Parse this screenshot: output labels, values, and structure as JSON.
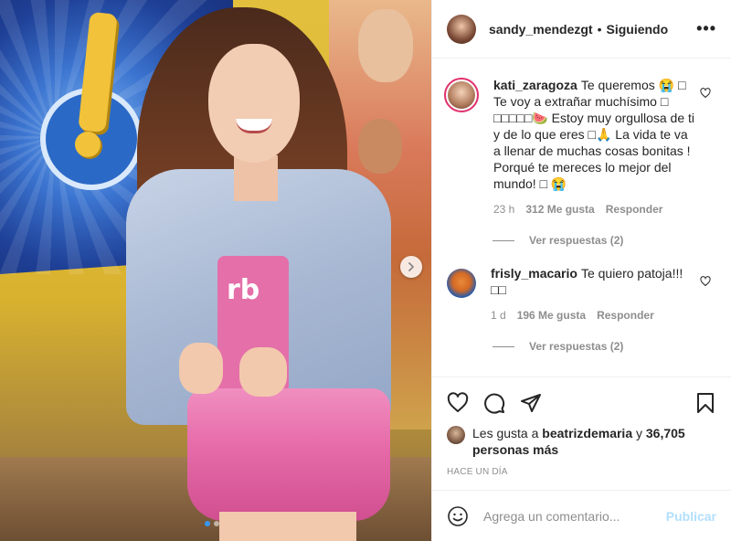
{
  "header": {
    "username": "sandy_mendezgt",
    "separator": "•",
    "follow_status": "Siguiendo",
    "more_label": "•••"
  },
  "photo": {
    "shirt_letters": "rb",
    "carousel_index": 1,
    "carousel_total": 2
  },
  "comments": [
    {
      "username": "kati_zaragoza",
      "text": "Te queremos 😭 □ Te voy a extrañar muchísimo □ □□□□□🍉 Estoy muy orgullosa de ti y de lo que eres □🙏 La vida te va a llenar de muchas cosas bonitas ! Porqué te mereces lo mejor del mundo! □ 😭",
      "time": "23 h",
      "likes": "312 Me gusta",
      "reply_label": "Responder",
      "view_replies": "Ver respuestas (2)"
    },
    {
      "username": "frisly_macario",
      "text": "Te quiero patoja!!! □□",
      "time": "1 d",
      "likes": "196 Me gusta",
      "reply_label": "Responder",
      "view_replies": "Ver respuestas (2)"
    }
  ],
  "likes": {
    "prefix": "Les gusta a",
    "user": "beatrizdemaria",
    "conjunction": "y",
    "others": "36,705 personas más"
  },
  "posted_time": "HACE UN DÍA",
  "add_comment": {
    "placeholder": "Agrega un comentario...",
    "post_label": "Publicar"
  },
  "colors": {
    "accent_blue": "#3897f0",
    "post_disabled": "#b2dffc",
    "story_ring": "#e1306c",
    "muted_text": "#8e8e8e"
  },
  "icons": [
    "more-icon",
    "heart-icon",
    "comment-icon",
    "share-icon",
    "bookmark-icon",
    "emoji-icon",
    "chevron-right-icon"
  ]
}
